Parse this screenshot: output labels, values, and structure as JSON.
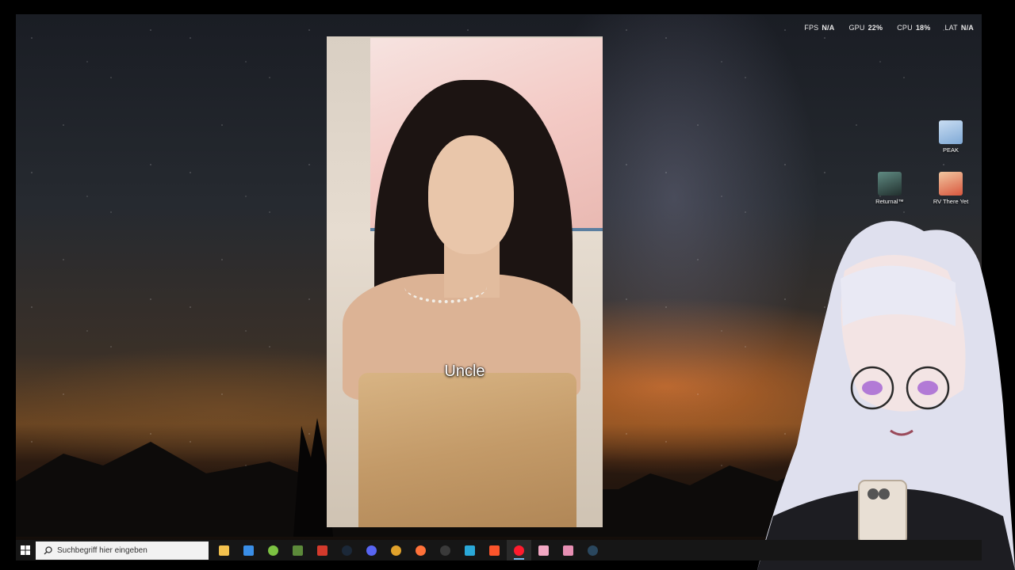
{
  "overlay": {
    "stats": [
      {
        "label": "FPS",
        "value": "N/A"
      },
      {
        "label": "GPU",
        "value": "22%"
      },
      {
        "label": "CPU",
        "value": "18%"
      },
      {
        "label": "LAT",
        "value": "N/A"
      }
    ]
  },
  "desktop": {
    "icons": [
      {
        "label": "PEAK",
        "icon": "peak-game-icon",
        "color": "#a7c6e4"
      },
      {
        "label": "Returnal™",
        "icon": "returnal-game-icon",
        "color": "#3c5a57"
      },
      {
        "label": "RV There Yet",
        "icon": "rv-there-yet-game-icon",
        "color": "#d9573e"
      }
    ]
  },
  "video": {
    "subtitle": "Uncle"
  },
  "taskbar": {
    "search_placeholder": "Suchbegriff hier eingeben",
    "apps": [
      {
        "name": "file-explorer-icon",
        "color": "#f2c14e"
      },
      {
        "name": "store-icon",
        "color": "#3a8ee6"
      },
      {
        "name": "android-app-icon",
        "color": "#7cc242"
      },
      {
        "name": "minecraft-icon",
        "color": "#5c8a3a"
      },
      {
        "name": "voice-app-icon",
        "color": "#d33a2c"
      },
      {
        "name": "steam-icon",
        "color": "#1b2838"
      },
      {
        "name": "discord-icon",
        "color": "#5865f2"
      },
      {
        "name": "chrome-icon",
        "color": "#e0a12b"
      },
      {
        "name": "firefox-icon",
        "color": "#ff7139"
      },
      {
        "name": "obs-icon",
        "color": "#3a3a3a"
      },
      {
        "name": "sync-app-icon",
        "color": "#2aa8d8"
      },
      {
        "name": "brave-icon",
        "color": "#fb542b"
      },
      {
        "name": "opera-icon",
        "color": "#ff1b2d"
      },
      {
        "name": "vtube-app-icon",
        "color": "#f2a7c3"
      },
      {
        "name": "sticker-app-icon",
        "color": "#e78fb3"
      },
      {
        "name": "steam-icon-2",
        "color": "#2a475e"
      }
    ],
    "active_app_index": 12
  }
}
